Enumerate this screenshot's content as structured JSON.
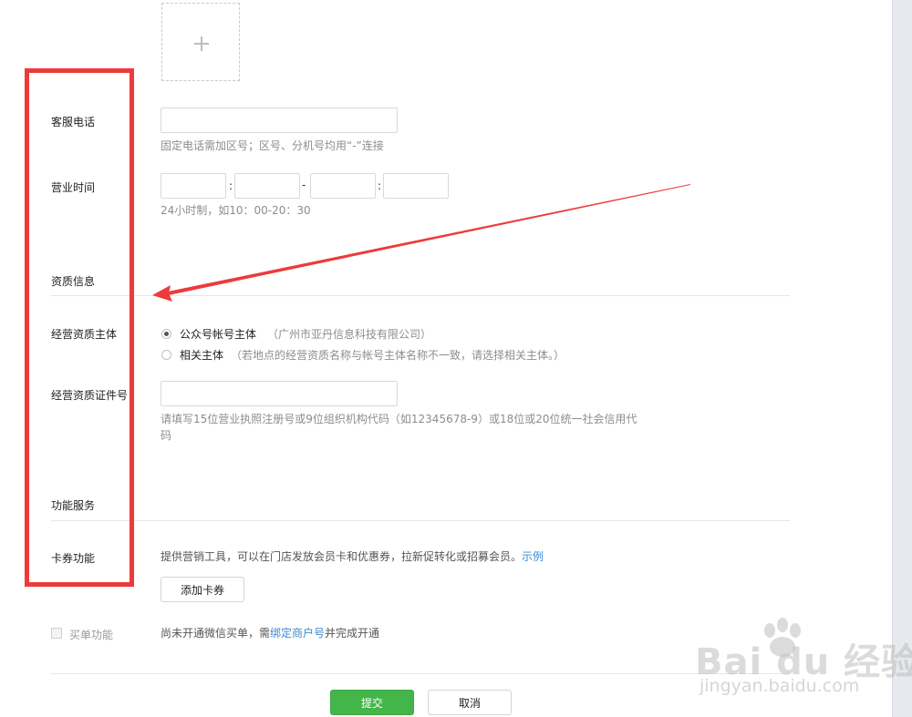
{
  "upload": {
    "icon": "plus-icon"
  },
  "customer_phone": {
    "label": "客服电话",
    "value": "",
    "hint": "固定电话需加区号；区号、分机号均用“-”连接"
  },
  "business_hours": {
    "label": "营业时间",
    "colon": ":",
    "dash": "-",
    "start_hour": "",
    "start_minute": "",
    "end_hour": "",
    "end_minute": "",
    "hint": "24小时制，如10：00-20：30"
  },
  "qualification": {
    "section_title": "资质信息",
    "subject_label": "经营资质主体",
    "options": [
      {
        "label": "公众号帐号主体",
        "note": "（广州市亚丹信息科技有限公司）",
        "selected": true
      },
      {
        "label": "相关主体",
        "note": "（若地点的经营资质名称与帐号主体名称不一致，请选择相关主体。）",
        "selected": false
      }
    ],
    "cert_label": "经营资质证件号",
    "cert_value": "",
    "cert_hint_line1": "请填写15位营业执照注册号或9位组织机构代码（如12345678-9）或18位或20位统一社会信用代",
    "cert_hint_line2": "码"
  },
  "services": {
    "section_title": "功能服务",
    "card_label": "卡券功能",
    "card_desc": "提供营销工具，可以在门店发放会员卡和优惠券，拉新促转化或招募会员。",
    "card_example_link": "示例",
    "add_card_button": "添加卡券",
    "buy_label": "买单功能",
    "buy_desc_prefix": "尚未开通微信买单，需",
    "buy_desc_link": "绑定商户号",
    "buy_desc_suffix": "并完成开通"
  },
  "actions": {
    "submit": "提交",
    "cancel": "取消"
  },
  "annotation": {
    "frame_color": "#ee3a3a",
    "arrow_color": "#ee3a3a"
  },
  "watermark": {
    "line1": "Bai du 经验",
    "line2": "jingyan.baidu.com"
  },
  "colors": {
    "primary": "#44b549",
    "link": "#3a8ad4"
  }
}
